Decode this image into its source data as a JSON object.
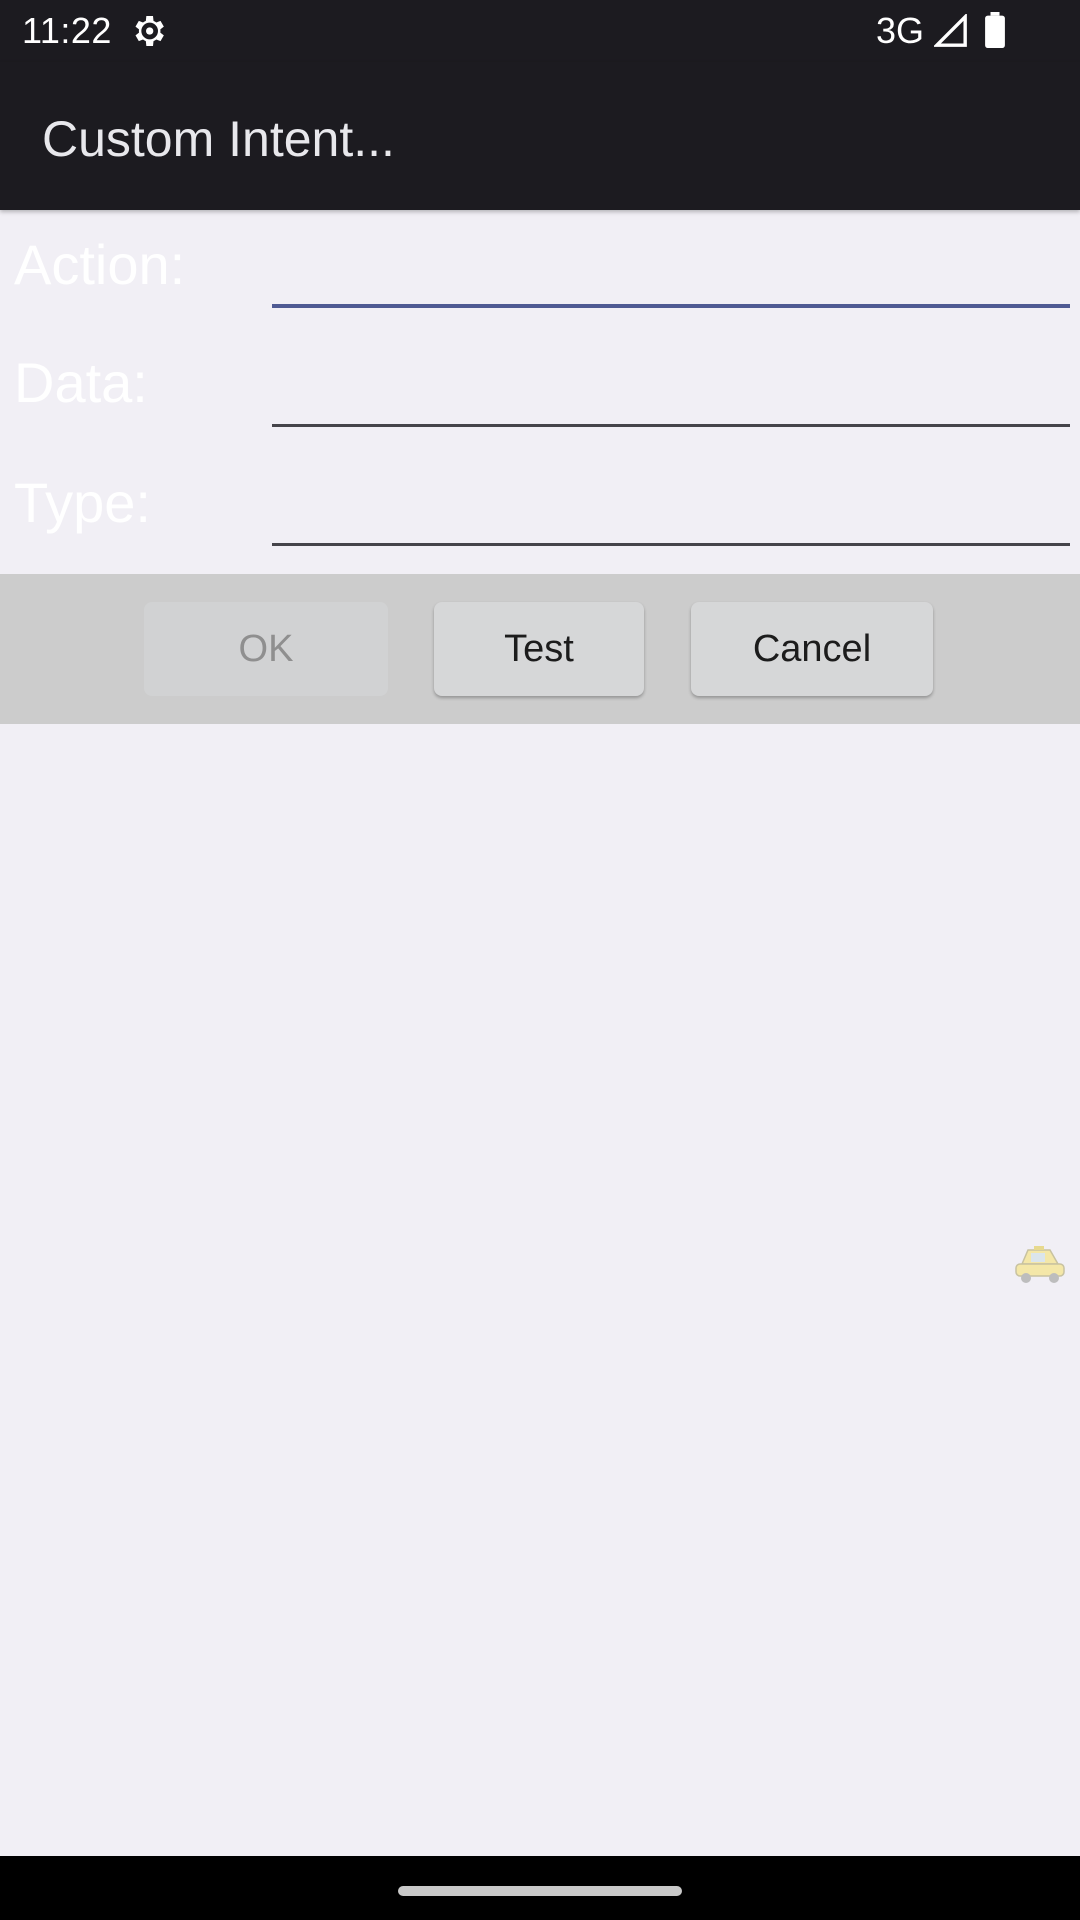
{
  "status_bar": {
    "time": "11:22",
    "network": "3G",
    "icons": [
      "gear-icon",
      "signal-icon",
      "battery-icon"
    ]
  },
  "app_bar": {
    "title": "Custom Intent..."
  },
  "form": {
    "action": {
      "label": "Action:",
      "value": ""
    },
    "data": {
      "label": "Data:",
      "value": ""
    },
    "type": {
      "label": "Type:",
      "value": ""
    }
  },
  "buttons": {
    "ok": "OK",
    "test": "Test",
    "cancel": "Cancel"
  },
  "overlay": {
    "icon": "taxi-icon"
  },
  "colors": {
    "bar_background": "#1c1b20",
    "content_background": "#f1eff5",
    "focus_underline": "#4f5a93",
    "button_bar": "#cccccc"
  }
}
